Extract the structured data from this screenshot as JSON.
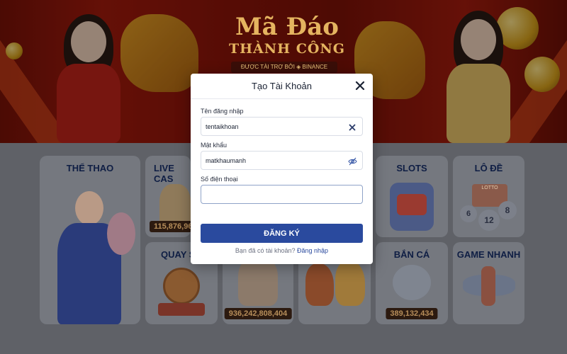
{
  "banner": {
    "title": "Mã Đáo",
    "subtitle": "THÀNH CÔNG",
    "sponsor": "ĐƯỢC TÀI TRỢ BỞI ◈ BINANCE"
  },
  "cards": {
    "the_thao": {
      "title": "THỂ THAO"
    },
    "live_casino": {
      "title": "LIVE CAS",
      "amount": "115,876,96"
    },
    "slots": {
      "title": "SLOTS"
    },
    "lo_de": {
      "title": "LÔ ĐỀ",
      "lotto": "LOTTO",
      "balls": [
        "6",
        "12",
        "8"
      ]
    },
    "quay_so": {
      "title": "QUAY S"
    },
    "no_hu": {
      "amount": "936,242,808,404"
    },
    "ban_ca": {
      "title": "BẮN CÁ",
      "amount": "389,132,434"
    },
    "game_nhanh": {
      "title": "GAME NHANH"
    }
  },
  "modal": {
    "title": "Tạo Tài Khoản",
    "close_icon": "close-icon",
    "username": {
      "label": "Tên đăng nhập",
      "value": "tentaikhoan",
      "icon": "clear-icon"
    },
    "password": {
      "label": "Mật khẩu",
      "value": "matkhaumanh",
      "icon": "eye-slash-icon"
    },
    "phone": {
      "label": "Số điện thoại",
      "value": ""
    },
    "submit_label": "ĐĂNG KÝ",
    "login_prompt": "Bạn đã có tài khoản?",
    "login_link": "Đăng nhập"
  },
  "colors": {
    "primary": "#2a4a9e",
    "banner_red": "#a31a0c",
    "gold": "#f5c76a",
    "card_title": "#0f1e44"
  }
}
